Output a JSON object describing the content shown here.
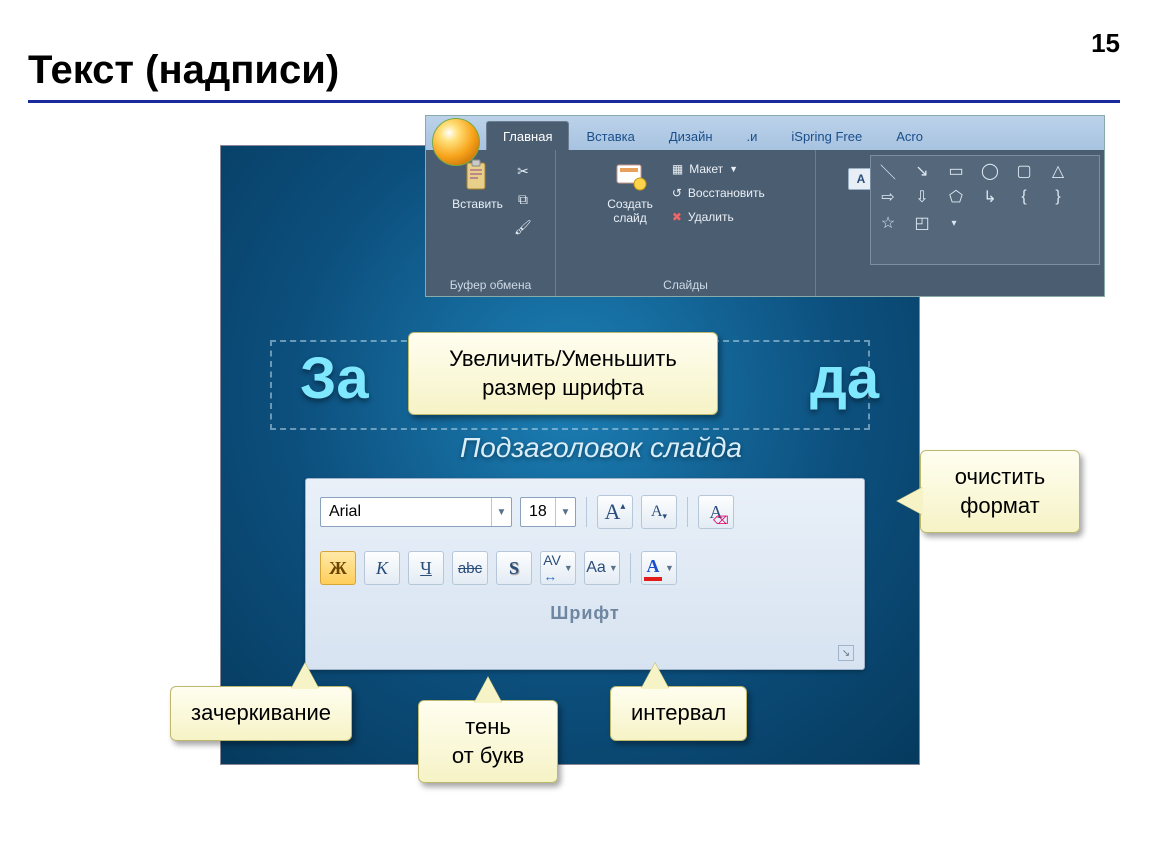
{
  "page": {
    "number": "15",
    "title": "Текст (надписи)"
  },
  "slide": {
    "title_fragment_left": "За",
    "title_fragment_right": "да",
    "subtitle": "Подзаголовок слайда"
  },
  "ribbon": {
    "tabs": [
      "Главная",
      "Вставка",
      "Дизайн",
      ".и",
      "iSpring Free",
      "Acro"
    ],
    "active_tab_index": 0,
    "groups": {
      "clipboard": {
        "paste": "Вставить",
        "caption": "Буфер обмена"
      },
      "slides": {
        "new_slide": "Создать\nслайд",
        "layout": "Макет",
        "reset": "Восстановить",
        "delete": "Удалить",
        "caption": "Слайды"
      }
    }
  },
  "font_toolbar": {
    "font_name": "Arial",
    "font_size": "18",
    "caption": "Шрифт",
    "buttons": {
      "grow_font": "A",
      "shrink_font": "A",
      "clear_format": "A",
      "bold": "Ж",
      "italic": "К",
      "underline": "Ч",
      "strike": "abc",
      "shadow": "S",
      "char_spacing": "AV",
      "change_case": "Aa",
      "font_color": "A"
    }
  },
  "callouts": {
    "grow_shrink": "Увеличить/Уменьшить\nразмер шрифта",
    "clear_format": "очистить\nформат",
    "strike": "зачеркивание",
    "shadow": "тень\nот букв",
    "spacing": "интервал"
  }
}
